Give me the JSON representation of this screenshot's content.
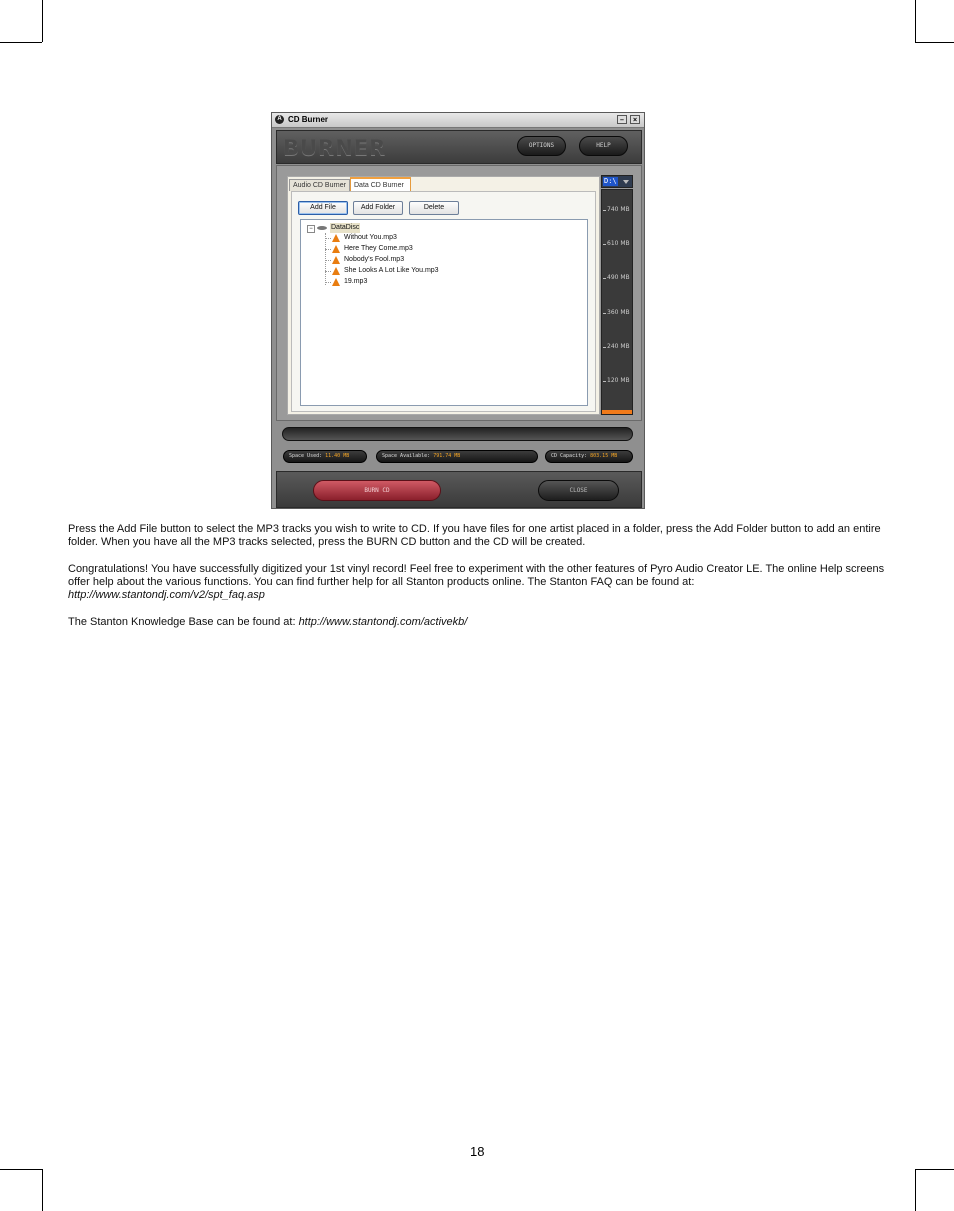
{
  "window": {
    "title": "CD Burner",
    "logo": "BURNER",
    "options_label": "OPTIONS",
    "help_label": "HELP",
    "minimize_glyph": "–",
    "close_glyph": "×",
    "app_icon_glyph": "A",
    "tabs": [
      {
        "label": "Audio CD Burner",
        "active": false
      },
      {
        "label": "Data CD Burner",
        "active": true
      }
    ],
    "buttons": {
      "add_file": "Add File",
      "add_folder": "Add Folder",
      "delete": "Delete"
    },
    "tree": {
      "collapse_glyph": "−",
      "root": "DataDisc",
      "files": [
        "Without You.mp3",
        "Here They Come.mp3",
        "Nobody's Fool.mp3",
        "She Looks A Lot Like You.mp3",
        "19.mp3"
      ]
    },
    "drive": "D:\\",
    "meter": {
      "labels": [
        "740 MB",
        "610 MB",
        "490 MB",
        "360 MB",
        "240 MB",
        "120 MB"
      ],
      "fill_color": "#f07a1a"
    },
    "stats": {
      "space_used_label": "Space Used:",
      "space_used_value": "11.40 MB",
      "space_available_label": "Space Available:",
      "space_available_value": "791.74 MB",
      "capacity_label": "CD Capacity:",
      "capacity_value": "803.15 MB"
    },
    "burn_label": "BURN CD",
    "close_label": "CLOSE"
  },
  "text": {
    "p1": "Press the Add File button to select the MP3 tracks you wish to write to CD. If you have files for one artist placed in a folder, press the Add Folder button to add an entire folder. When you have all the MP3 tracks selected, press the BURN CD button and the CD will be created.",
    "p2": "Congratulations! You have successfully digitized your 1st vinyl record!    Feel free to experiment with the other features of Pyro Audio Creator LE. The online Help screens offer help about the various functions. You can find further help for all Stanton products online. The Stanton FAQ can be found at:",
    "faq_url": "http://www.stantondj.com/v2/spt_faq.asp",
    "p3": "The Stanton Knowledge Base can be found at: ",
    "kb_url": "http://www.stantondj.com/activekb/"
  },
  "page_number": "18"
}
